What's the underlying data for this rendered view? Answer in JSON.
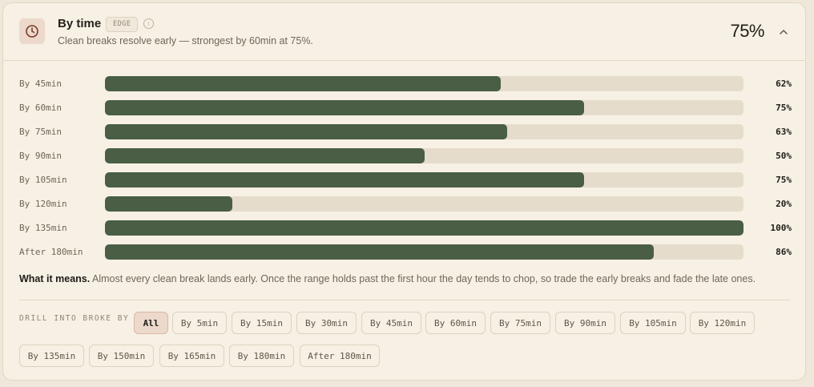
{
  "header": {
    "title": "By time",
    "badge": "EDGE",
    "subtitle": "Clean breaks resolve early — strongest by 60min at 75%.",
    "headline_pct": "75%",
    "info_icon": "info-icon",
    "clock_icon": "clock-icon",
    "collapse_icon": "chevron-up-icon"
  },
  "rows": [
    {
      "label": "By 45min",
      "pct_text": "62%",
      "value": 62
    },
    {
      "label": "By 60min",
      "pct_text": "75%",
      "value": 75
    },
    {
      "label": "By 75min",
      "pct_text": "63%",
      "value": 63
    },
    {
      "label": "By 90min",
      "pct_text": "50%",
      "value": 50
    },
    {
      "label": "By 105min",
      "pct_text": "75%",
      "value": 75
    },
    {
      "label": "By 120min",
      "pct_text": "20%",
      "value": 20
    },
    {
      "label": "By 135min",
      "pct_text": "100%",
      "value": 100
    },
    {
      "label": "After 180min",
      "pct_text": "86%",
      "value": 86
    }
  ],
  "meaning": {
    "lead": "What it means.",
    "text": "Almost every clean break lands early. Once the range holds past the first hour the day tends to chop, so trade the early breaks and fade the late ones."
  },
  "drill": {
    "label": "DRILL INTO BROKE BY",
    "selected": "All",
    "chips": [
      "All",
      "By 5min",
      "By 15min",
      "By 30min",
      "By 45min",
      "By 60min",
      "By 75min",
      "By 90min",
      "By 105min",
      "By 120min",
      "By 135min",
      "By 150min",
      "By 165min",
      "By 180min",
      "After 180min"
    ]
  },
  "colors": {
    "bar_fill": "#4a5d45",
    "bar_track": "#e6dccb",
    "card_bg": "#f7f0e4",
    "accent_chip": "#ecd9cb"
  }
}
